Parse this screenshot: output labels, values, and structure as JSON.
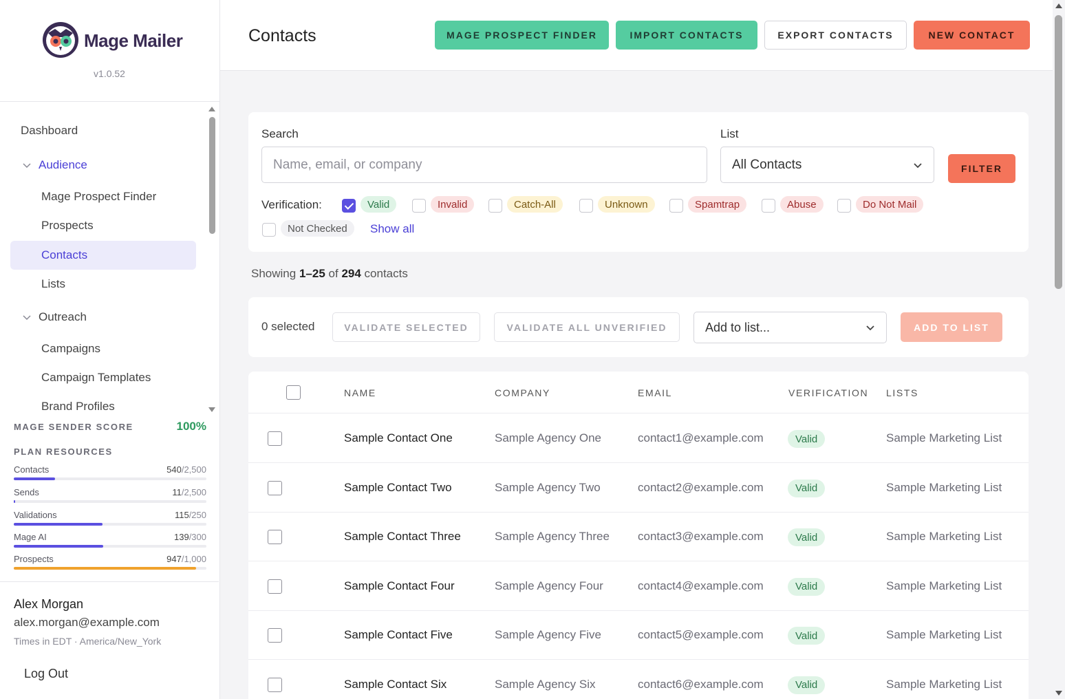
{
  "app": {
    "name": "Mage Mailer",
    "version": "v1.0.52"
  },
  "sidebar": {
    "nav": {
      "dashboard": "Dashboard",
      "audience": "Audience",
      "mage_prospect_finder": "Mage Prospect Finder",
      "prospects": "Prospects",
      "contacts": "Contacts",
      "lists": "Lists",
      "outreach": "Outreach",
      "campaigns": "Campaigns",
      "campaign_templates": "Campaign Templates",
      "brand_profiles": "Brand Profiles"
    },
    "sender_score": {
      "label": "MAGE SENDER SCORE",
      "value": "100%"
    },
    "plan_resources": {
      "label": "PLAN RESOURCES",
      "items": [
        {
          "label": "Contacts",
          "used": "540",
          "limit": "/2,500",
          "fraction": 0.216
        },
        {
          "label": "Sends",
          "used": "11",
          "limit": "/2,500",
          "fraction": 0.0044
        },
        {
          "label": "Validations",
          "used": "115",
          "limit": "/250",
          "fraction": 0.46
        },
        {
          "label": "Mage AI",
          "used": "139",
          "limit": "/300",
          "fraction": 0.463
        },
        {
          "label": "Prospects",
          "used": "947",
          "limit": "/1,000",
          "fraction": 0.947,
          "warn": true
        }
      ]
    },
    "user": {
      "name": "Alex Morgan",
      "email": "alex.morgan@example.com",
      "timezone": "Times in EDT · America/New_York",
      "logout": "Log Out"
    }
  },
  "header": {
    "title": "Contacts",
    "buttons": {
      "prospect_finder": "MAGE PROSPECT FINDER",
      "import": "IMPORT CONTACTS",
      "export": "EXPORT CONTACTS",
      "new": "NEW CONTACT"
    }
  },
  "filters": {
    "search_label": "Search",
    "search_placeholder": "Name, email, or company",
    "list_label": "List",
    "list_value": "All Contacts",
    "filter_button": "FILTER",
    "verification_label": "Verification:",
    "statuses": [
      {
        "label": "Valid",
        "checked": true
      },
      {
        "label": "Invalid",
        "checked": false
      },
      {
        "label": "Catch-All",
        "checked": false
      },
      {
        "label": "Unknown",
        "checked": false
      },
      {
        "label": "Spamtrap",
        "checked": false
      },
      {
        "label": "Abuse",
        "checked": false
      },
      {
        "label": "Do Not Mail",
        "checked": false
      },
      {
        "label": "Not Checked",
        "checked": false
      }
    ],
    "show_all": "Show all"
  },
  "summary": {
    "prefix": "Showing",
    "range": "1–25",
    "of": "of",
    "total": "294",
    "suffix": "contacts"
  },
  "bulk": {
    "selected": "0 selected",
    "validate_selected": "VALIDATE SELECTED",
    "validate_all": "VALIDATE ALL UNVERIFIED",
    "add_to_list_placeholder": "Add to list...",
    "add_to_list_button": "ADD TO LIST"
  },
  "table": {
    "columns": [
      "NAME",
      "COMPANY",
      "EMAIL",
      "VERIFICATION",
      "LISTS"
    ],
    "rows": [
      {
        "name": "Sample Contact One",
        "company": "Sample Agency One",
        "email": "contact1@example.com",
        "verification": "Valid",
        "lists": "Sample Marketing List"
      },
      {
        "name": "Sample Contact Two",
        "company": "Sample Agency Two",
        "email": "contact2@example.com",
        "verification": "Valid",
        "lists": "Sample Marketing List"
      },
      {
        "name": "Sample Contact Three",
        "company": "Sample Agency Three",
        "email": "contact3@example.com",
        "verification": "Valid",
        "lists": "Sample Marketing List"
      },
      {
        "name": "Sample Contact Four",
        "company": "Sample Agency Four",
        "email": "contact4@example.com",
        "verification": "Valid",
        "lists": "Sample Marketing List"
      },
      {
        "name": "Sample Contact Five",
        "company": "Sample Agency Five",
        "email": "contact5@example.com",
        "verification": "Valid",
        "lists": "Sample Marketing List"
      },
      {
        "name": "Sample Contact Six",
        "company": "Sample Agency Six",
        "email": "contact6@example.com",
        "verification": "Valid",
        "lists": "Sample Marketing List"
      }
    ]
  },
  "colors": {
    "accent": "#5b50e0",
    "green_button": "#55cca0",
    "orange_button": "#f4745a",
    "valid_badge": "#dff4e6"
  }
}
